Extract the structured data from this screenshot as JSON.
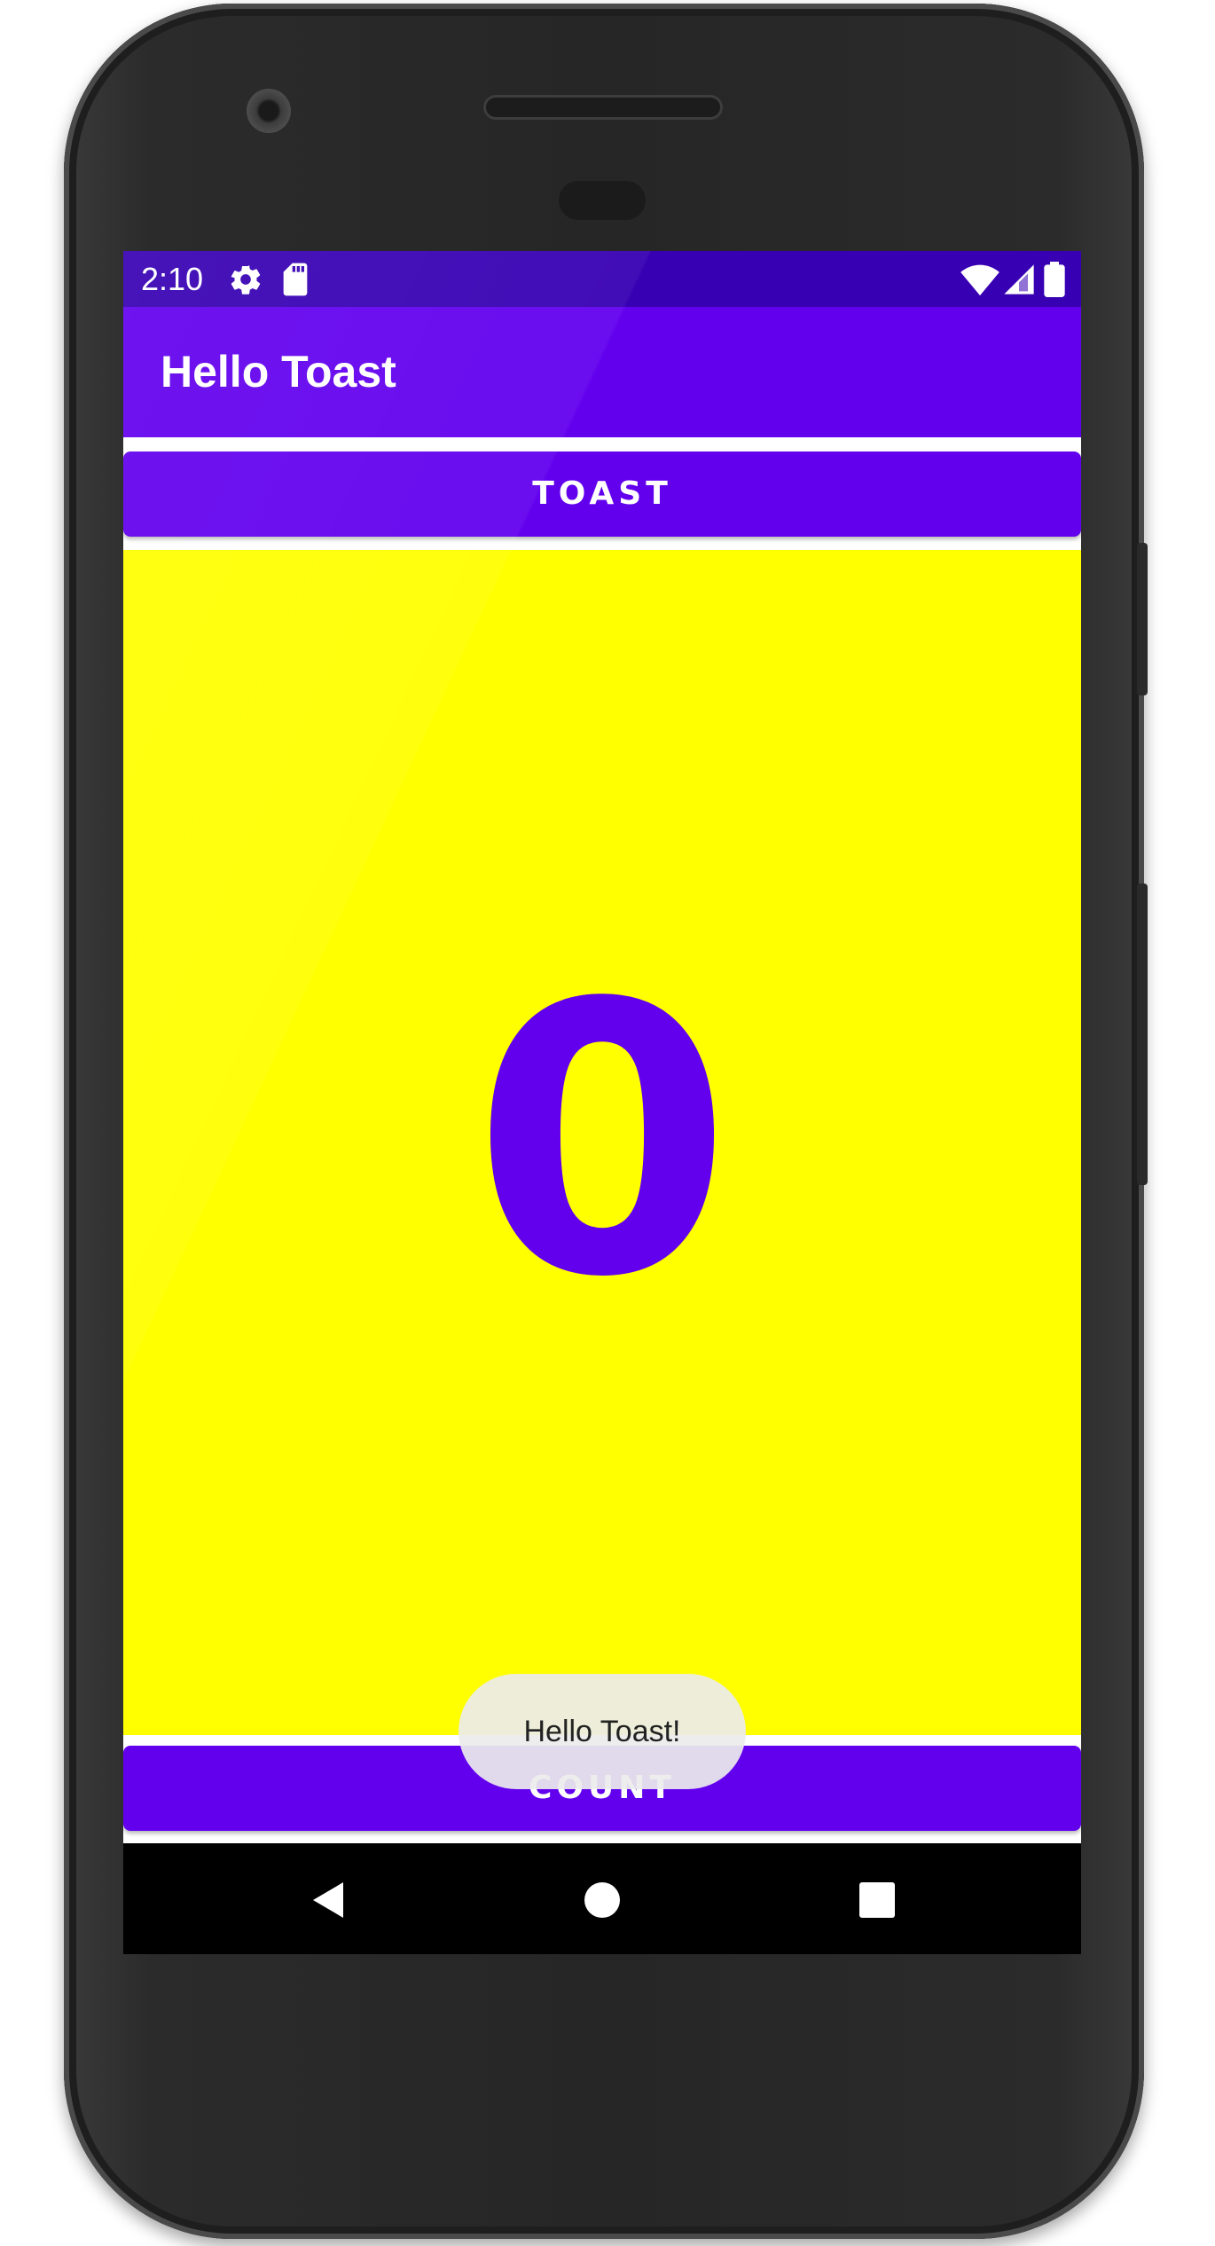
{
  "status_bar": {
    "time": "2:10",
    "icons_left": [
      "gear-icon",
      "sd-card-icon"
    ],
    "icons_right": [
      "wifi-icon",
      "cell-signal-icon",
      "battery-icon"
    ]
  },
  "app_bar": {
    "title": "Hello Toast"
  },
  "buttons": {
    "toast_label": "TOAST",
    "count_label": "COUNT"
  },
  "counter": {
    "value": "0"
  },
  "toast": {
    "message": "Hello Toast!"
  },
  "navigation": {
    "buttons": [
      "back",
      "home",
      "recents"
    ]
  },
  "colors": {
    "primary": "#6200ee",
    "primary_dark": "#3700b3",
    "panel_background": "#ffff00",
    "counter_text": "#6200ee"
  }
}
